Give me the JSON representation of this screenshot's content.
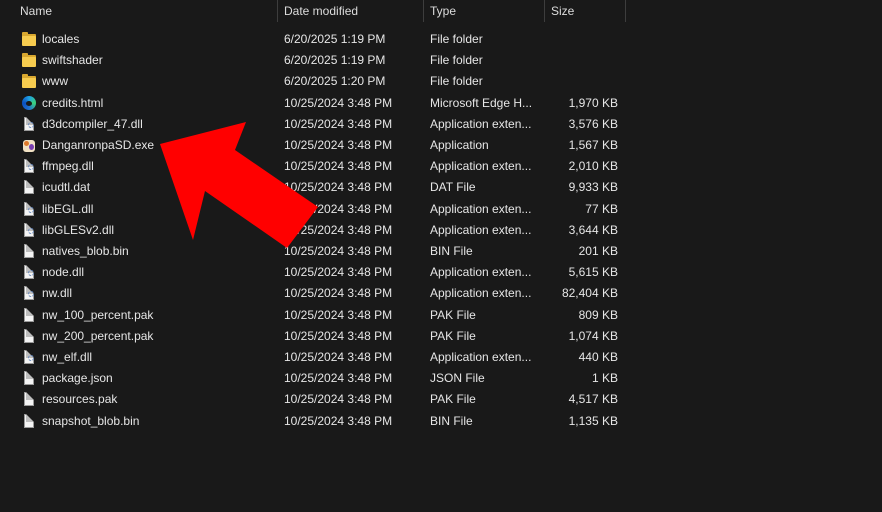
{
  "columns": {
    "name": "Name",
    "date": "Date modified",
    "type": "Type",
    "size": "Size"
  },
  "files": [
    {
      "name": "locales",
      "date": "6/20/2025 1:19 PM",
      "type": "File folder",
      "size": "",
      "icon": "folder-icon"
    },
    {
      "name": "swiftshader",
      "date": "6/20/2025 1:19 PM",
      "type": "File folder",
      "size": "",
      "icon": "folder-icon"
    },
    {
      "name": "www",
      "date": "6/20/2025 1:20 PM",
      "type": "File folder",
      "size": "",
      "icon": "folder-icon"
    },
    {
      "name": "credits.html",
      "date": "10/25/2024 3:48 PM",
      "type": "Microsoft Edge H...",
      "size": "1,970 KB",
      "icon": "edge-icon"
    },
    {
      "name": "d3dcompiler_47.dll",
      "date": "10/25/2024 3:48 PM",
      "type": "Application exten...",
      "size": "3,576 KB",
      "icon": "dll-icon"
    },
    {
      "name": "DanganronpaSD.exe",
      "date": "10/25/2024 3:48 PM",
      "type": "Application",
      "size": "1,567 KB",
      "icon": "exe-icon"
    },
    {
      "name": "ffmpeg.dll",
      "date": "10/25/2024 3:48 PM",
      "type": "Application exten...",
      "size": "2,010 KB",
      "icon": "dll-icon"
    },
    {
      "name": "icudtl.dat",
      "date": "10/25/2024 3:48 PM",
      "type": "DAT File",
      "size": "9,933 KB",
      "icon": "file-icon"
    },
    {
      "name": "libEGL.dll",
      "date": "10/25/2024 3:48 PM",
      "type": "Application exten...",
      "size": "77 KB",
      "icon": "dll-icon"
    },
    {
      "name": "libGLESv2.dll",
      "date": "10/25/2024 3:48 PM",
      "type": "Application exten...",
      "size": "3,644 KB",
      "icon": "dll-icon"
    },
    {
      "name": "natives_blob.bin",
      "date": "10/25/2024 3:48 PM",
      "type": "BIN File",
      "size": "201 KB",
      "icon": "file-icon"
    },
    {
      "name": "node.dll",
      "date": "10/25/2024 3:48 PM",
      "type": "Application exten...",
      "size": "5,615 KB",
      "icon": "dll-icon"
    },
    {
      "name": "nw.dll",
      "date": "10/25/2024 3:48 PM",
      "type": "Application exten...",
      "size": "82,404 KB",
      "icon": "dll-icon"
    },
    {
      "name": "nw_100_percent.pak",
      "date": "10/25/2024 3:48 PM",
      "type": "PAK File",
      "size": "809 KB",
      "icon": "file-icon"
    },
    {
      "name": "nw_200_percent.pak",
      "date": "10/25/2024 3:48 PM",
      "type": "PAK File",
      "size": "1,074 KB",
      "icon": "file-icon"
    },
    {
      "name": "nw_elf.dll",
      "date": "10/25/2024 3:48 PM",
      "type": "Application exten...",
      "size": "440 KB",
      "icon": "dll-icon"
    },
    {
      "name": "package.json",
      "date": "10/25/2024 3:48 PM",
      "type": "JSON File",
      "size": "1 KB",
      "icon": "file-icon"
    },
    {
      "name": "resources.pak",
      "date": "10/25/2024 3:48 PM",
      "type": "PAK File",
      "size": "4,517 KB",
      "icon": "file-icon"
    },
    {
      "name": "snapshot_blob.bin",
      "date": "10/25/2024 3:48 PM",
      "type": "BIN File",
      "size": "1,135 KB",
      "icon": "file-icon"
    }
  ],
  "colors": {
    "background": "#191919",
    "text": "#e6e6e6",
    "arrow": "#ff0000"
  }
}
